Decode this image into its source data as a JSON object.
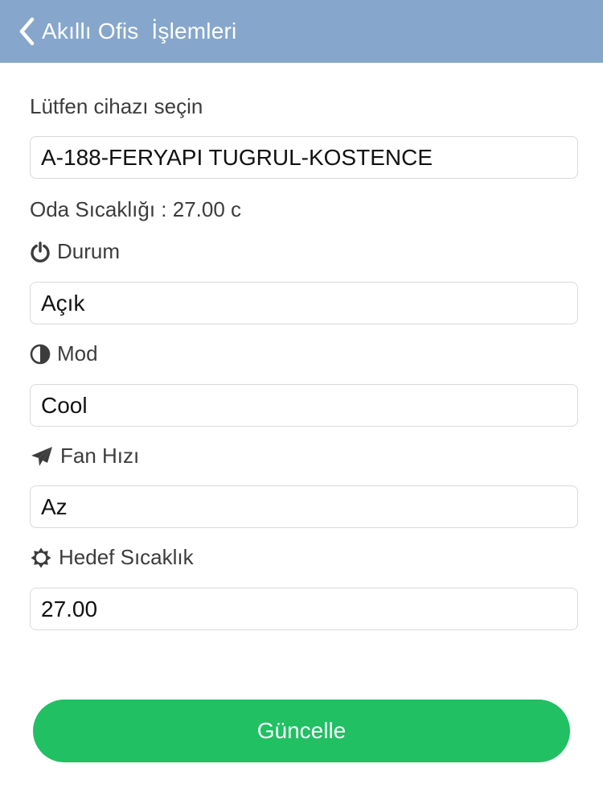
{
  "header": {
    "title": "Akıllı Ofis  İşlemleri",
    "back_icon": "chevron-left-icon",
    "background_color": "#86a7cb"
  },
  "device": {
    "label": "Lütfen cihazı seçin",
    "value": "A-188-FERYAPI TUGRUL-KOSTENCE"
  },
  "room_temperature": {
    "text": "Oda Sıcaklığı : 27.00 c"
  },
  "status": {
    "icon": "power-icon",
    "label": "Durum",
    "value": "Açık"
  },
  "mode": {
    "icon": "half-circle-icon",
    "label": "Mod",
    "value": "Cool"
  },
  "fan_speed": {
    "icon": "paper-plane-icon",
    "label": "Fan Hızı",
    "value": "Az"
  },
  "target_temperature": {
    "icon": "sun-icon",
    "label": "Hedef Sıcaklık",
    "value": "27.00"
  },
  "update_button": {
    "label": "Güncelle",
    "color": "#20c063"
  }
}
